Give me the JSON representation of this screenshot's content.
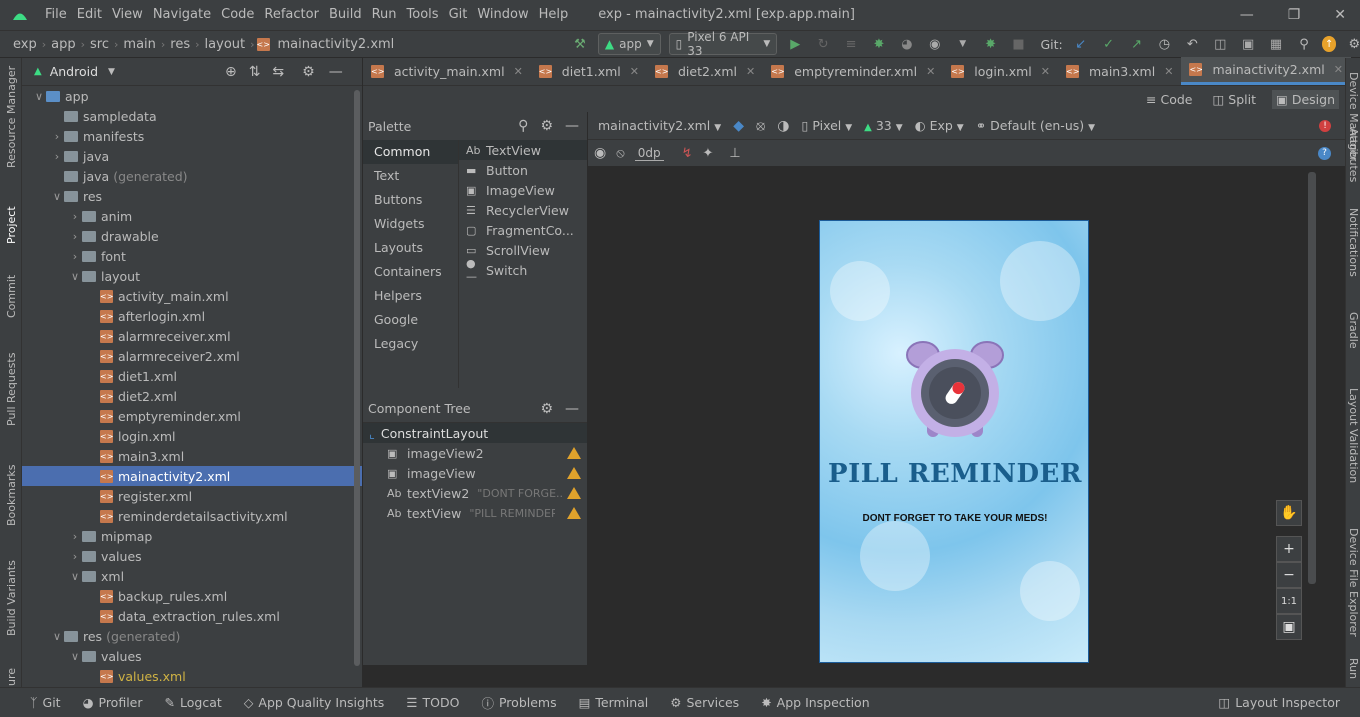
{
  "menu": {
    "items": [
      "File",
      "Edit",
      "View",
      "Navigate",
      "Code",
      "Refactor",
      "Build",
      "Run",
      "Tools",
      "Git",
      "Window",
      "Help"
    ],
    "title": "exp - mainactivity2.xml [exp.app.main]"
  },
  "navbar": {
    "breadcrumb": [
      "exp",
      "app",
      "src",
      "main",
      "res",
      "layout",
      "mainactivity2.xml"
    ],
    "run_config": "app",
    "device": "Pixel 6 API 33",
    "git_label": "Git:"
  },
  "left_strip": [
    "Resource Manager",
    "Project",
    "Commit",
    "Pull Requests",
    "Bookmarks",
    "Build Variants",
    "ure"
  ],
  "right_strip": [
    "Device Manager",
    "Attributes",
    "Notifications",
    "Gradle",
    "Layout Validation",
    "Device File Explorer",
    "Run"
  ],
  "project": {
    "view_label": "Android",
    "tree": [
      {
        "label": "app",
        "depth": 0,
        "arrow": "down",
        "kind": "module"
      },
      {
        "label": "sampledata",
        "depth": 1,
        "arrow": "",
        "kind": "folder"
      },
      {
        "label": "manifests",
        "depth": 1,
        "arrow": "right",
        "kind": "folder"
      },
      {
        "label": "java",
        "depth": 1,
        "arrow": "right",
        "kind": "folder"
      },
      {
        "label": "java",
        "suffix": "(generated)",
        "depth": 1,
        "arrow": "",
        "kind": "folder"
      },
      {
        "label": "res",
        "depth": 1,
        "arrow": "down",
        "kind": "folder"
      },
      {
        "label": "anim",
        "depth": 2,
        "arrow": "right",
        "kind": "folder"
      },
      {
        "label": "drawable",
        "depth": 2,
        "arrow": "right",
        "kind": "folder"
      },
      {
        "label": "font",
        "depth": 2,
        "arrow": "right",
        "kind": "folder"
      },
      {
        "label": "layout",
        "depth": 2,
        "arrow": "down",
        "kind": "folder"
      },
      {
        "label": "activity_main.xml",
        "depth": 3,
        "arrow": "",
        "kind": "xml"
      },
      {
        "label": "afterlogin.xml",
        "depth": 3,
        "arrow": "",
        "kind": "xml"
      },
      {
        "label": "alarmreceiver.xml",
        "depth": 3,
        "arrow": "",
        "kind": "xml"
      },
      {
        "label": "alarmreceiver2.xml",
        "depth": 3,
        "arrow": "",
        "kind": "xml"
      },
      {
        "label": "diet1.xml",
        "depth": 3,
        "arrow": "",
        "kind": "xml"
      },
      {
        "label": "diet2.xml",
        "depth": 3,
        "arrow": "",
        "kind": "xml"
      },
      {
        "label": "emptyreminder.xml",
        "depth": 3,
        "arrow": "",
        "kind": "xml"
      },
      {
        "label": "login.xml",
        "depth": 3,
        "arrow": "",
        "kind": "xml"
      },
      {
        "label": "main3.xml",
        "depth": 3,
        "arrow": "",
        "kind": "xml"
      },
      {
        "label": "mainactivity2.xml",
        "depth": 3,
        "arrow": "",
        "kind": "xml",
        "selected": true
      },
      {
        "label": "register.xml",
        "depth": 3,
        "arrow": "",
        "kind": "xml"
      },
      {
        "label": "reminderdetailsactivity.xml",
        "depth": 3,
        "arrow": "",
        "kind": "xml"
      },
      {
        "label": "mipmap",
        "depth": 2,
        "arrow": "right",
        "kind": "folder"
      },
      {
        "label": "values",
        "depth": 2,
        "arrow": "right",
        "kind": "folder"
      },
      {
        "label": "xml",
        "depth": 2,
        "arrow": "down",
        "kind": "folder"
      },
      {
        "label": "backup_rules.xml",
        "depth": 3,
        "arrow": "",
        "kind": "xml"
      },
      {
        "label": "data_extraction_rules.xml",
        "depth": 3,
        "arrow": "",
        "kind": "xml"
      },
      {
        "label": "res",
        "suffix": "(generated)",
        "depth": 1,
        "arrow": "down",
        "kind": "folder"
      },
      {
        "label": "values",
        "depth": 2,
        "arrow": "down",
        "kind": "folder"
      },
      {
        "label": "values.xml",
        "depth": 3,
        "arrow": "",
        "kind": "xmlgen"
      }
    ]
  },
  "tabs": [
    "activity_main.xml",
    "diet1.xml",
    "diet2.xml",
    "emptyreminder.xml",
    "login.xml",
    "main3.xml",
    "mainactivity2.xml"
  ],
  "active_tab": "mainactivity2.xml",
  "modes": [
    "Code",
    "Split",
    "Design"
  ],
  "palette": {
    "title": "Palette",
    "categories": [
      "Common",
      "Text",
      "Buttons",
      "Widgets",
      "Layouts",
      "Containers",
      "Helpers",
      "Google",
      "Legacy"
    ],
    "items": [
      "TextView",
      "Button",
      "ImageView",
      "RecyclerView",
      "FragmentCo...",
      "ScrollView",
      "Switch"
    ]
  },
  "component_tree": {
    "title": "Component Tree",
    "root": "ConstraintLayout",
    "children": [
      {
        "icon": "image",
        "name": "imageView2",
        "hint": ""
      },
      {
        "icon": "image",
        "name": "imageView",
        "hint": ""
      },
      {
        "icon": "text",
        "name": "textView2",
        "hint": "\"DONT FORGE..."
      },
      {
        "icon": "text",
        "name": "textView",
        "hint": "\"PILL REMINDER"
      }
    ]
  },
  "design_toolbar": {
    "file": "mainactivity2.xml",
    "device": "Pixel",
    "api": "33",
    "theme": "Exp",
    "locale": "Default (en-us)",
    "margin": "0dp"
  },
  "phone": {
    "title": "PILL REMINDER",
    "subtitle": "DONT FORGET TO TAKE YOUR MEDS!"
  },
  "zoom": {
    "one_to_one": "1:1"
  },
  "bottom": {
    "items": [
      "Git",
      "Profiler",
      "Logcat",
      "App Quality Insights",
      "TODO",
      "Problems",
      "Terminal",
      "Services",
      "App Inspection"
    ],
    "right": "Layout Inspector"
  },
  "colors": {
    "accent": "#4a88c7",
    "title": "#1a5e8c",
    "warning": "#e0a22c"
  }
}
